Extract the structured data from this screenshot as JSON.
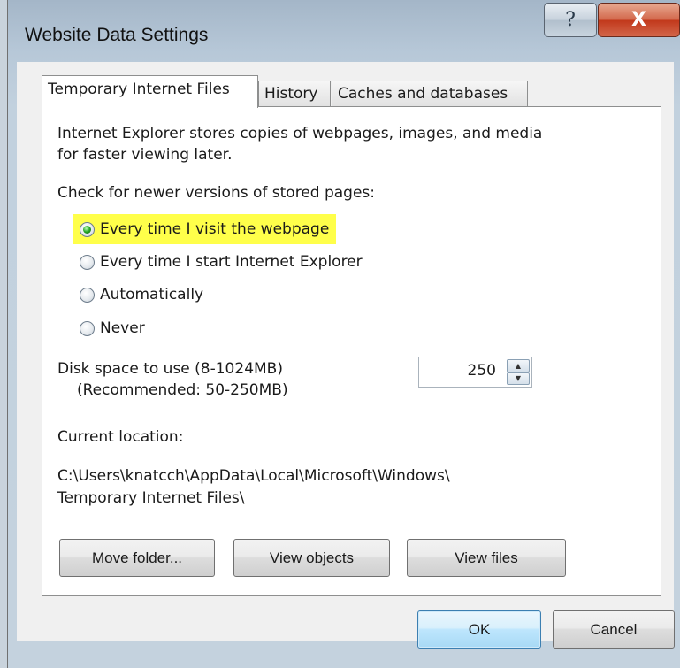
{
  "window": {
    "title": "Website Data Settings",
    "help_glyph": "?",
    "close_glyph": "X"
  },
  "tabs": [
    {
      "label": "Temporary Internet Files",
      "active": true
    },
    {
      "label": "History",
      "active": false
    },
    {
      "label": "Caches and databases",
      "active": false
    }
  ],
  "panel": {
    "description_line1": "Internet Explorer stores copies of webpages, images, and media",
    "description_line2": "for faster viewing later.",
    "check_label": "Check for newer versions of stored pages:",
    "options": [
      {
        "label": "Every time I visit the webpage",
        "selected": true,
        "highlighted": true
      },
      {
        "label": "Every time I start Internet Explorer",
        "selected": false
      },
      {
        "label": "Automatically",
        "selected": false
      },
      {
        "label": "Never",
        "selected": false
      }
    ],
    "disk_label_line1": "Disk space to use (8-1024MB)",
    "disk_label_line2": "(Recommended: 50-250MB)",
    "disk_value": "250",
    "spin_up": "▲",
    "spin_down": "▼",
    "location_label": "Current location:",
    "location_line1": "C:\\Users\\knatcch\\AppData\\Local\\Microsoft\\Windows\\",
    "location_line2": "Temporary Internet Files\\",
    "buttons": {
      "move_folder": "Move folder...",
      "view_objects": "View objects",
      "view_files": "View files"
    }
  },
  "footer": {
    "ok": "OK",
    "cancel": "Cancel"
  },
  "colors": {
    "highlight": "#ffff4a",
    "close_button": "#c2391c",
    "default_button": "#bee6fd"
  }
}
